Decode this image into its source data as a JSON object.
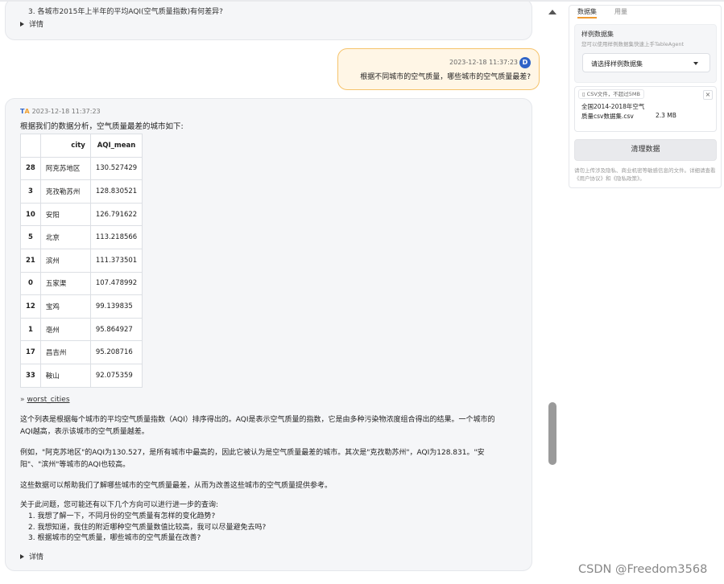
{
  "chat": {
    "prev_question_3": "3. 各城市2015年上半年的平均AQI(空气质量指数)有何差异?",
    "details_label": "详情",
    "user_message": {
      "avatar_letter": "D",
      "timestamp": "2023-12-18 11:37:23",
      "text": "根据不同城市的空气质量，哪些城市的空气质量最差?"
    },
    "bot_message": {
      "logo_text_left": "T",
      "logo_text_right": "A",
      "timestamp": "2023-12-18 11:37:23",
      "intro": "根据我们的数据分析，空气质量最差的城市如下:",
      "table": {
        "headers": [
          "",
          "city",
          "AQI_mean"
        ],
        "rows": [
          [
            "28",
            "阿克苏地区",
            "130.527429"
          ],
          [
            "3",
            "克孜勒苏州",
            "128.830521"
          ],
          [
            "10",
            "安阳",
            "126.791622"
          ],
          [
            "5",
            "北京",
            "113.218566"
          ],
          [
            "21",
            "滨州",
            "111.373501"
          ],
          [
            "0",
            "五家渠",
            "107.478992"
          ],
          [
            "12",
            "宝鸡",
            "99.139835"
          ],
          [
            "1",
            "亳州",
            "95.864927"
          ],
          [
            "17",
            "昌吉州",
            "95.208716"
          ],
          [
            "33",
            "鞍山",
            "92.075359"
          ]
        ]
      },
      "dataset_link_bullet": "»",
      "dataset_link": "worst_cities",
      "para1_line1": "这个列表是根据每个城市的平均空气质量指数（AQI）排序得出的。AQI是表示空气质量的指数，它是由多种污染物浓度组合得出的结果。一个城市的",
      "para1_line2": "AQI越高，表示该城市的空气质量越差。",
      "para2_line1": "例如，\"阿克苏地区\"的AQI为130.527，是所有城市中最高的，因此它被认为是空气质量最差的城市。其次是\"克孜勒苏州\"，AQI为128.831。\"安",
      "para2_line2": "阳\"、\"滨州\"等城市的AQI也较高。",
      "para3": "这些数据可以帮助我们了解哪些城市的空气质量最差，从而为改善这些城市的空气质量提供参考。",
      "followup_intro": "关于此问题，您可能还有以下几个方向可以进行进一步的查询:",
      "followups": [
        "1. 我想了解一下，不同月份的空气质量有怎样的变化趋势?",
        "2. 我想知道，我住的附近哪种空气质量数值比较高，我可以尽量避免去吗?",
        "3. 根据城市的空气质量，哪些城市的空气质量在改善?"
      ]
    }
  },
  "panel": {
    "tabs": [
      "数据集",
      "用量"
    ],
    "sample_title": "样例数据集",
    "sample_hint": "您可以使用样例数据集快速上手TableAgent",
    "select_value": "请选择样例数据集",
    "file_chip": "CSV文件，不超过5MB",
    "file_name": "全国2014-2018年空气质量csv数据集.csv",
    "file_size": "2.3 MB",
    "clear_button": "清理数据",
    "note": "请勿上传涉及隐私、商业机密等敏感信息的文件。详细请查看《用户协议》和《隐私政策》。"
  },
  "watermark": "CSDN @Freedom3568",
  "colors": {
    "accent_orange": "#f09a30",
    "user_bubble_bg": "#fff6e6",
    "user_bubble_border": "#f6c36b",
    "avatar_blue": "#2e63c7"
  },
  "icons": [
    "play-triangle-icon",
    "dropdown-arrow-icon",
    "file-icon",
    "close-icon",
    "scroll-up-icon"
  ]
}
